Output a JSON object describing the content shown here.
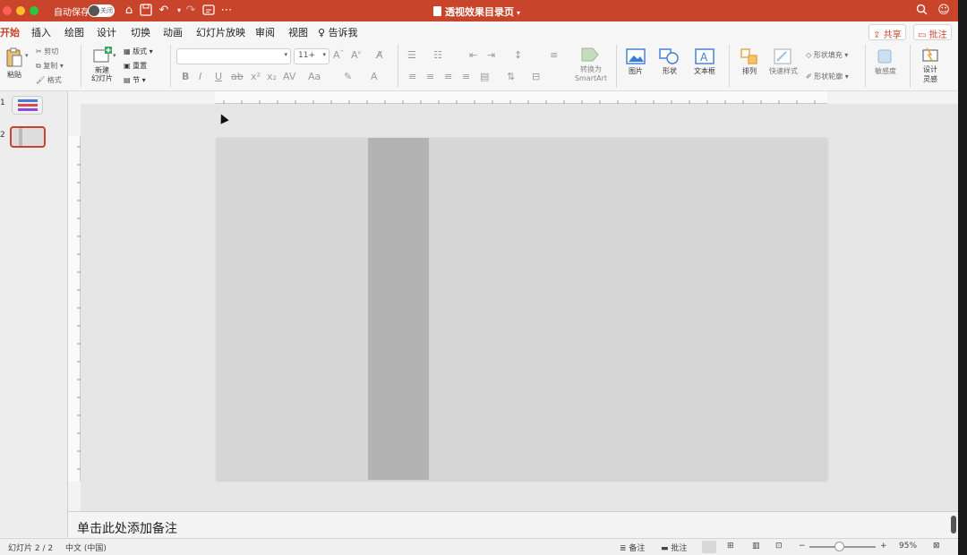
{
  "titlebar": {
    "autosave_label": "自动保存",
    "autosave_state": "关闭",
    "doc_title": "透视效果目录页",
    "icons": [
      "home-icon",
      "save-icon",
      "undo-icon",
      "redo-icon",
      "more-icon",
      "search-icon",
      "smiley-icon"
    ]
  },
  "tabs": {
    "items": [
      "开始",
      "插入",
      "绘图",
      "设计",
      "切换",
      "动画",
      "幻灯片放映",
      "审阅",
      "视图"
    ],
    "tell_me": "告诉我",
    "share": "共享",
    "comments": "批注"
  },
  "ribbon": {
    "paste": "粘贴",
    "cut": "剪切",
    "copy": "复制",
    "format": "格式",
    "new_slide": "新建\n幻灯片",
    "layout": "版式",
    "reset": "重置",
    "section": "节",
    "font_size": "11+",
    "convert_smartart_1": "转换为",
    "convert_smartart_2": "SmartArt",
    "picture": "图片",
    "shape": "形状",
    "textbox": "文本框",
    "arrange": "排列",
    "quick_styles": "快速样式",
    "shape_fill": "形状填充",
    "shape_outline": "形状轮廓",
    "sensitivity": "敏感度",
    "designer_1": "设计",
    "designer_2": "灵感"
  },
  "slides_panel": {
    "numbers": [
      "1",
      "2"
    ]
  },
  "notes": {
    "placeholder": "单击此处添加备注"
  },
  "status": {
    "slide_count": "幻灯片 2 / 2",
    "language": "中文 (中国)",
    "notes": "备注",
    "comments": "批注",
    "zoom": "95%",
    "zoom_level": 0.95
  },
  "colors": {
    "accent": "#c8442a",
    "slide_bg": "#d6d6d6",
    "slide_bar": "#b3b3b3"
  }
}
